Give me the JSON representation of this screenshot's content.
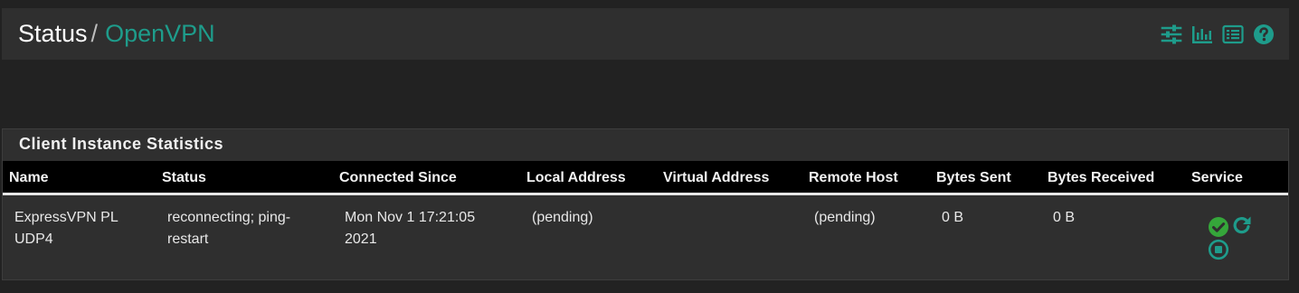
{
  "breadcrumb": {
    "root": "Status",
    "separator": "/",
    "current": "OpenVPN"
  },
  "header_icons": [
    "sliders-icon",
    "bar-chart-icon",
    "list-icon",
    "help-icon"
  ],
  "panel": {
    "title": "Client Instance Statistics",
    "columns": [
      "Name",
      "Status",
      "Connected Since",
      "Local Address",
      "Virtual Address",
      "Remote Host",
      "Bytes Sent",
      "Bytes Received",
      "Service"
    ],
    "rows": [
      {
        "name_line1": "ExpressVPN PL",
        "name_line2": "UDP4",
        "status_line1": "reconnecting; ping-",
        "status_line2": "restart",
        "connected_line1": "Mon Nov 1 17:21:05",
        "connected_line2": "2021",
        "local_address": "(pending)",
        "virtual_address": "",
        "remote_host": "(pending)",
        "bytes_sent": "0 B",
        "bytes_received": "0 B",
        "service_icons": [
          "check-circle-icon",
          "restart-icon",
          "stop-circle-icon"
        ]
      }
    ]
  },
  "colors": {
    "accent": "#1e9c8b",
    "service_running": "#35a63a",
    "background": "#222222",
    "panel": "#2f2f2f",
    "table_header": "#000000"
  }
}
